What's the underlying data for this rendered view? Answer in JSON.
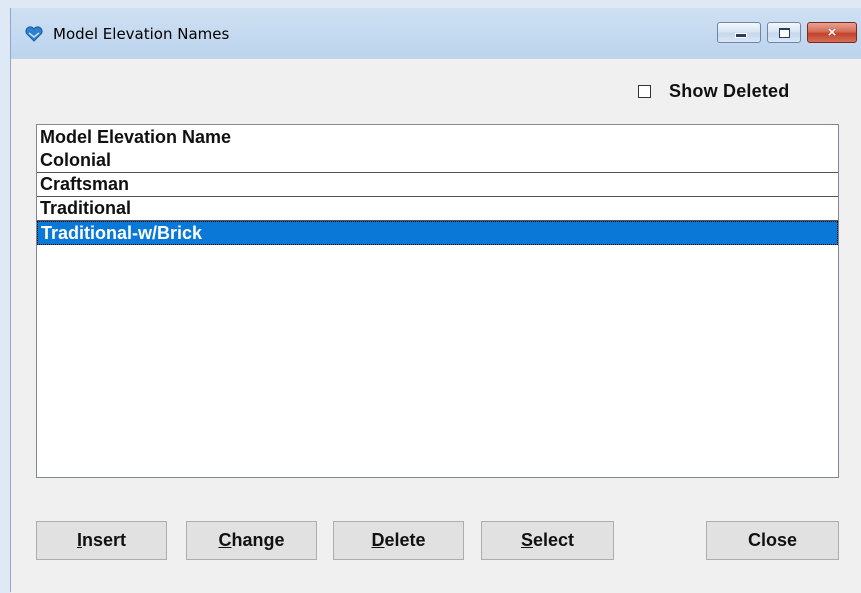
{
  "window": {
    "title": "Model Elevation Names",
    "controls": {
      "minimize_icon": "minimize-icon",
      "maximize_icon": "maximize-icon",
      "close_glyph": "×"
    }
  },
  "show_deleted": {
    "label": "Show Deleted",
    "checked": false
  },
  "list": {
    "header": "Model Elevation Name",
    "rows": [
      "Colonial",
      "Craftsman",
      "Traditional",
      "Traditional-w/Brick"
    ],
    "selected_index": 3
  },
  "buttons": {
    "insert": {
      "mnemonic": "I",
      "rest": "nsert"
    },
    "change": {
      "mnemonic": "C",
      "rest": "hange"
    },
    "delete": {
      "mnemonic": "D",
      "rest": "elete"
    },
    "select": {
      "mnemonic": "S",
      "rest": "elect"
    },
    "close": "Close"
  },
  "colors": {
    "selection": "#0a78d7",
    "dialog_background": "#f0f0f0",
    "close_button": "#c2432a"
  }
}
